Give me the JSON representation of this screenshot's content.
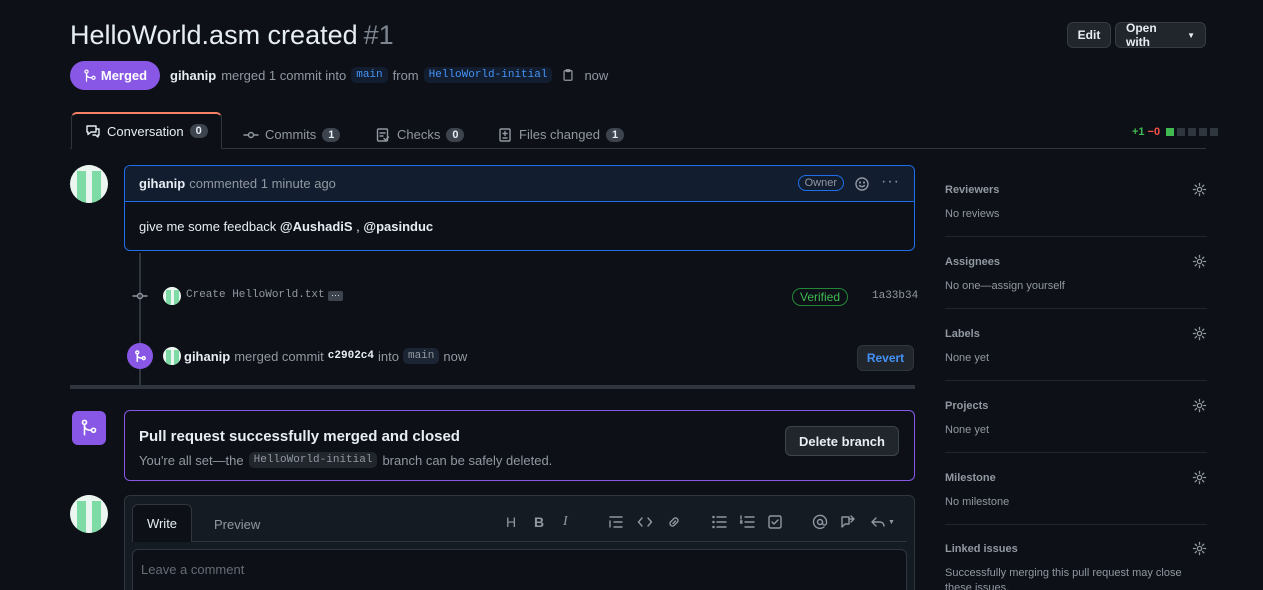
{
  "pr": {
    "title": "HelloWorld.asm created",
    "number": "#1",
    "status": "Merged",
    "author": "gihanip",
    "merge_text": "merged 1 commit into",
    "base_branch": "main",
    "from_text": "from",
    "head_branch": "HelloWorld-initial",
    "time": "now"
  },
  "header_buttons": {
    "edit": "Edit",
    "open_with": "Open with"
  },
  "tabs": [
    {
      "label": "Conversation",
      "count": "0"
    },
    {
      "label": "Commits",
      "count": "1"
    },
    {
      "label": "Checks",
      "count": "0"
    },
    {
      "label": "Files changed",
      "count": "1"
    }
  ],
  "diffstat": {
    "additions": "+1",
    "deletions": "−0"
  },
  "comment": {
    "author": "gihanip",
    "time_text": "commented 1 minute ago",
    "role": "Owner",
    "body_prefix": "give me some feedback",
    "mention1": "@AushadiS",
    "sep": " , ",
    "mention2": "@pasinduc"
  },
  "commit": {
    "message": "Create HelloWorld.txt",
    "verified": "Verified",
    "sha": "1a33b34"
  },
  "merge_event": {
    "author": "gihanip",
    "text": "merged commit",
    "sha": "c2902c4",
    "into": "into",
    "branch": "main",
    "time": "now",
    "revert": "Revert"
  },
  "merge_box": {
    "title": "Pull request successfully merged and closed",
    "sub_prefix": "You're all set—the",
    "branch": "HelloWorld-initial",
    "sub_suffix": "branch can be safely deleted.",
    "delete_button": "Delete branch"
  },
  "editor": {
    "write": "Write",
    "preview": "Preview",
    "placeholder": "Leave a comment"
  },
  "sidebar": {
    "reviewers": {
      "label": "Reviewers",
      "value": "No reviews"
    },
    "assignees": {
      "label": "Assignees",
      "value": "No one—assign yourself"
    },
    "labels": {
      "label": "Labels",
      "value": "None yet"
    },
    "projects": {
      "label": "Projects",
      "value": "None yet"
    },
    "milestone": {
      "label": "Milestone",
      "value": "No milestone"
    },
    "linked": {
      "label": "Linked issues",
      "value": "Successfully merging this pull request may close these issues."
    }
  },
  "colors": {
    "accent": "#1f6feb",
    "merged": "#8957e5",
    "success": "#3fb950",
    "danger": "#f85149"
  }
}
